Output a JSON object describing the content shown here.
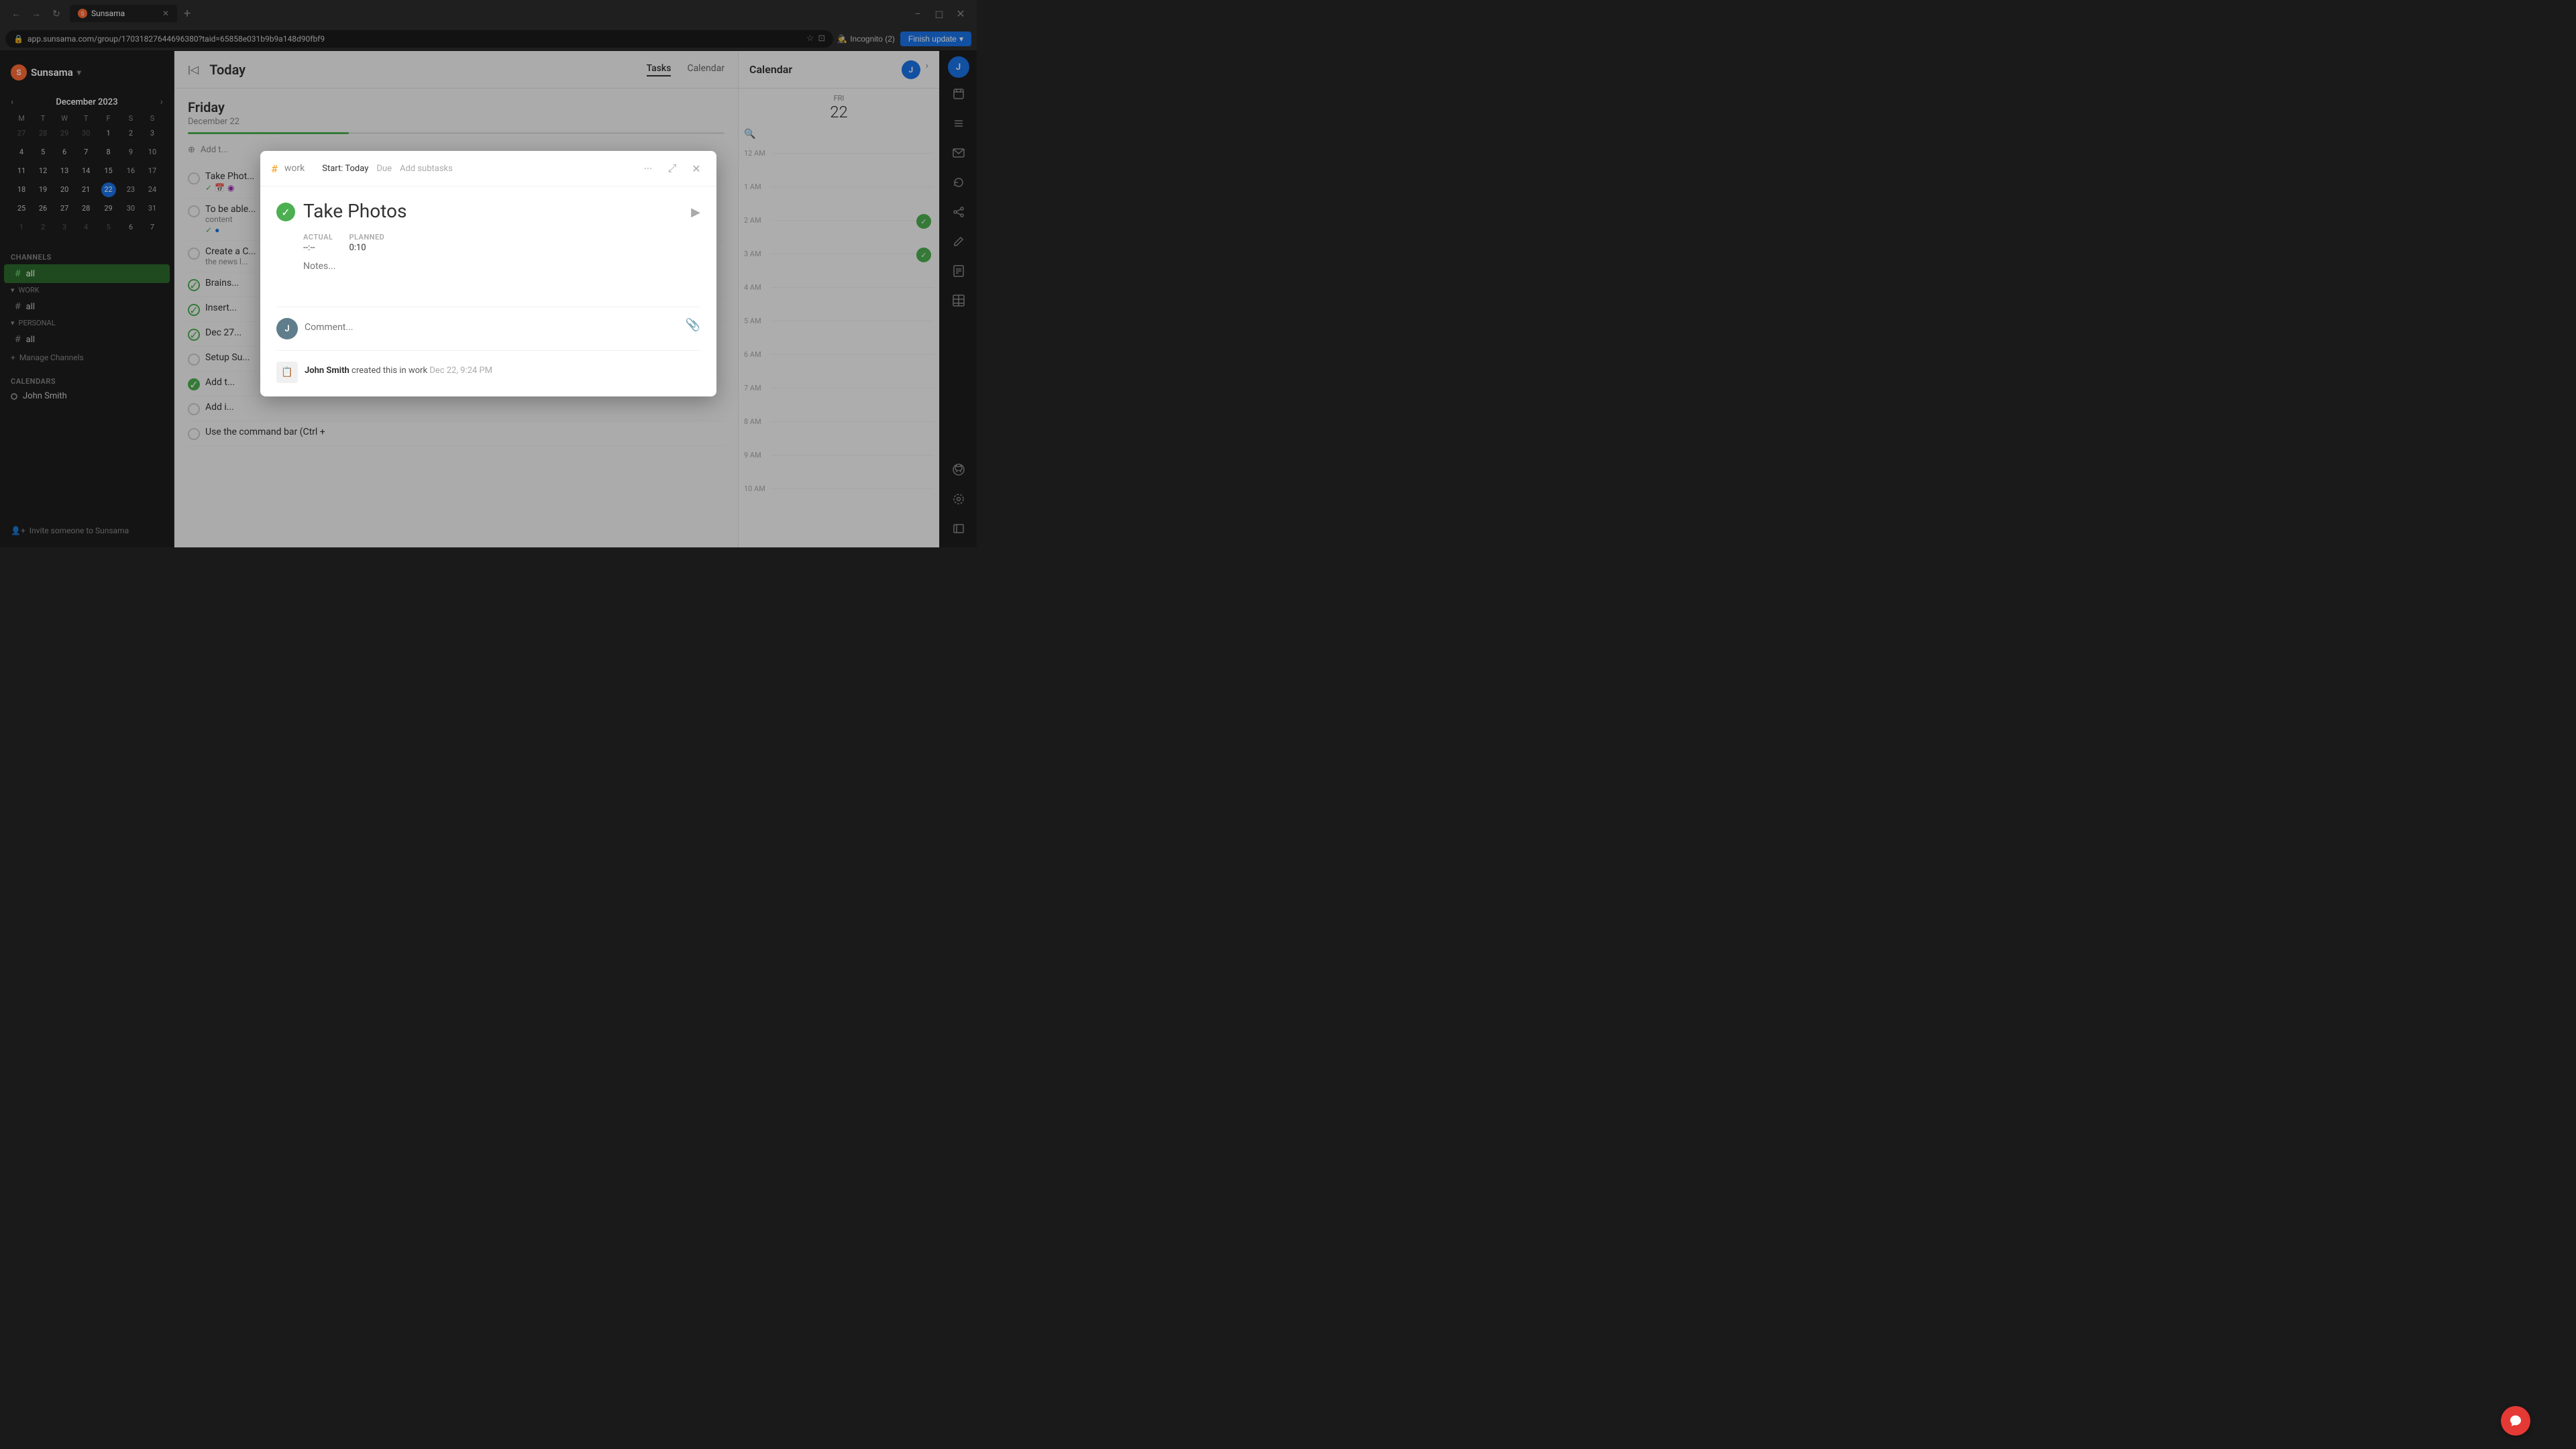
{
  "browser": {
    "tab_label": "Sunsama",
    "url": "app.sunsama.com/group/17031827644696380?taid=65858e031b9b9a148d90fbf9",
    "incognito_label": "Incognito (2)",
    "finish_update_label": "Finish update"
  },
  "app": {
    "title": "Sunsama"
  },
  "sidebar": {
    "calendar_month": "December 2023",
    "calendar_days": [
      "M",
      "T",
      "W",
      "T",
      "F",
      "S",
      "S"
    ],
    "channels_label": "CHANNELS",
    "channels_all": "all",
    "work_label": "WORK",
    "work_all": "all",
    "personal_label": "PERSONAL",
    "personal_all": "all",
    "manage_channels": "Manage Channels",
    "calendars_label": "CALENDARS",
    "calendar_user": "John Smith",
    "invite_label": "Invite someone to Sunsama"
  },
  "main": {
    "back_icon": "←",
    "page_title": "Today",
    "day_header": "Friday",
    "day_date": "December 22",
    "tab_tasks": "Tasks",
    "tab_calendar": "Calendar",
    "add_task_label": "Add t...",
    "tasks": [
      {
        "id": 1,
        "text": "Take Phot...",
        "checked": false,
        "icons": [
          "check",
          "calendar",
          "circle"
        ]
      },
      {
        "id": 2,
        "text": "To be able...",
        "subtext": "content",
        "checked": false,
        "icons": [
          "check",
          "circle-blue"
        ]
      },
      {
        "id": 3,
        "text": "Create a C...",
        "subtext": "the news l...",
        "checked": false
      },
      {
        "id": 4,
        "text": "Brains...",
        "checked": true
      },
      {
        "id": 5,
        "text": "Insert...",
        "checked": true
      },
      {
        "id": 6,
        "text": "Dec 27...",
        "checked": true
      },
      {
        "id": 7,
        "text": "Setup Su...",
        "checked": false
      },
      {
        "id": 8,
        "text": "Add t...",
        "checked": true
      },
      {
        "id": 9,
        "text": "Add i...",
        "checked": false
      },
      {
        "id": 10,
        "text": "Use the command bar (Ctrl +",
        "checked": false
      }
    ]
  },
  "calendar_panel": {
    "title": "Calendar",
    "fri_label": "FRI",
    "fri_date": "22",
    "times": [
      "12 AM",
      "1 AM",
      "2 AM",
      "3 AM",
      "4 AM",
      "5 AM",
      "6 AM",
      "7 AM",
      "8 AM",
      "9 AM",
      "10 AM"
    ]
  },
  "modal": {
    "channel_hash": "#",
    "channel_name": "work",
    "start_label": "Start:",
    "start_value": "Today",
    "due_label": "Due",
    "add_subtasks_label": "Add subtasks",
    "task_title": "Take Photos",
    "actual_label": "ACTUAL",
    "actual_value": "--:--",
    "planned_label": "PLANNED",
    "planned_value": "0:10",
    "notes_placeholder": "Notes...",
    "comment_placeholder": "Comment...",
    "activity_text": "John Smith created this in work",
    "activity_time": "Dec 22, 9:24 PM"
  }
}
